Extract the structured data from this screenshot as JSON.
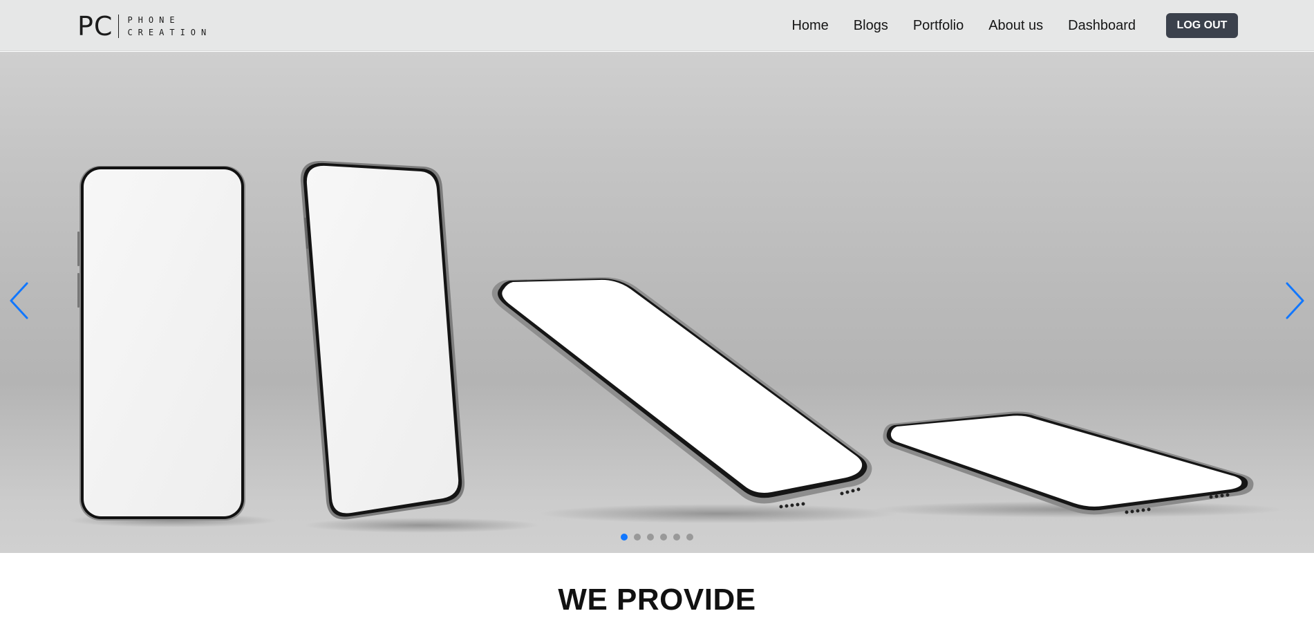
{
  "brand": {
    "mark": "PC",
    "line1": "PHONE",
    "line2": "CREATION"
  },
  "nav": {
    "links": [
      "Home",
      "Blogs",
      "Portfolio",
      "About us",
      "Dashboard"
    ],
    "logout_label": "LOG OUT"
  },
  "carousel": {
    "prev_icon": "chevron-left-icon",
    "next_icon": "chevron-right-icon",
    "slide_count": 6,
    "active_slide": 1,
    "arrow_color": "#1177ff",
    "background_color": "#b9b9b9"
  },
  "section": {
    "title": "WE PROVIDE"
  }
}
